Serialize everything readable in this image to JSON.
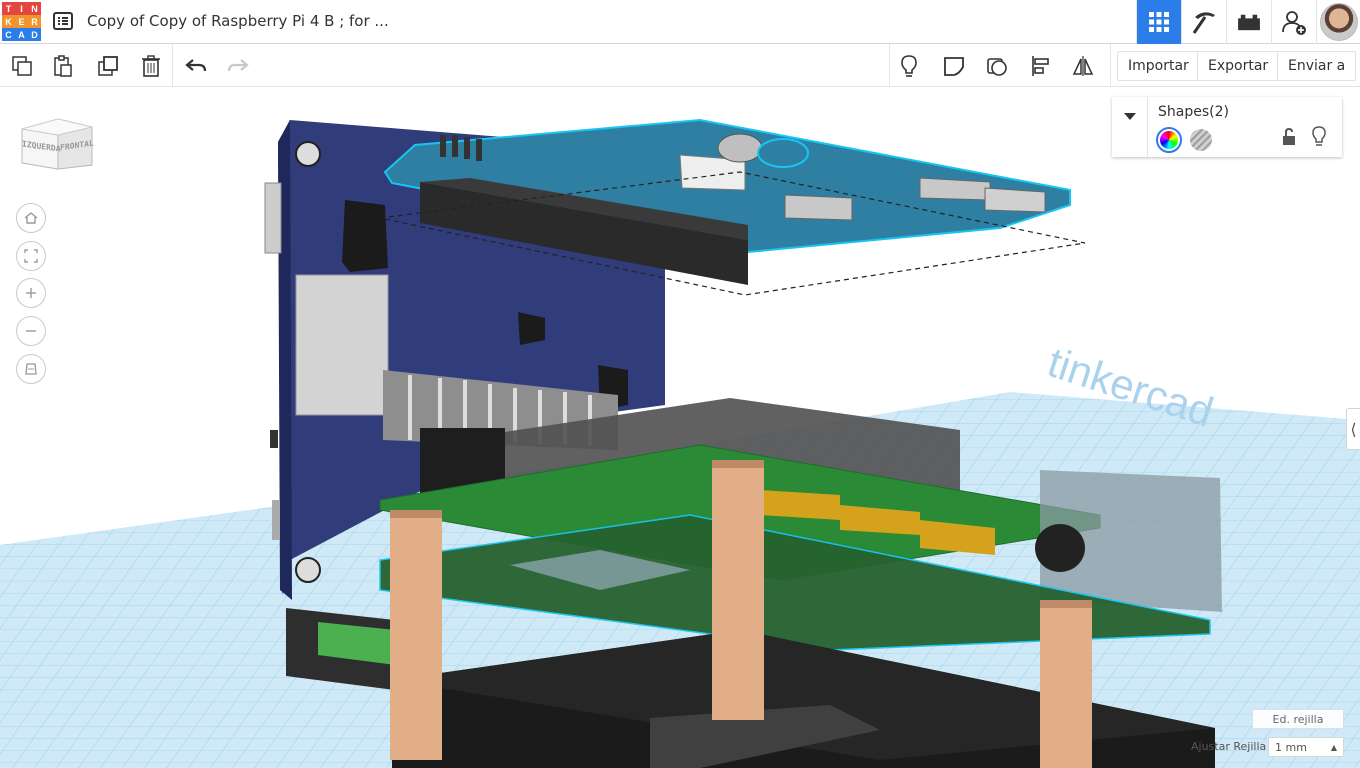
{
  "app": {
    "logo_letters": [
      "T",
      "I",
      "N",
      "K",
      "E",
      "R",
      "C",
      "A",
      "D"
    ],
    "logo_colors": [
      "#e2463f",
      "#e2463f",
      "#e2463f",
      "#f29330",
      "#f29330",
      "#f29330",
      "#2b7de9",
      "#2b7de9",
      "#2b7de9"
    ],
    "title": "Copy of Copy of Raspberry Pi 4 B ; for ...",
    "accent": "#2b7de9"
  },
  "topbar": {
    "icons": [
      "grid-view-icon",
      "pickaxe-icon",
      "bricks-icon",
      "add-user-icon",
      "avatar"
    ]
  },
  "toolbar": {
    "tools": [
      "copy-icon",
      "paste-icon",
      "duplicate-icon",
      "trash-icon",
      "undo-icon",
      "redo-icon"
    ],
    "view_tools": [
      "lightbulb-icon",
      "note-icon",
      "workplane-icon",
      "align-icon",
      "mirror-icon"
    ],
    "import_label": "Importar",
    "export_label": "Exportar",
    "send_label": "Enviar a"
  },
  "viewcube": {
    "left_face": "IZQUERDA",
    "front_face": "FRONTAL"
  },
  "nav_controls": [
    "home-icon",
    "fit-icon",
    "zoom-in-icon",
    "zoom-out-icon",
    "perspective-icon"
  ],
  "shapes_panel": {
    "title": "Shapes(2)"
  },
  "grid": {
    "edit_grid_label": "Ed. rejilla",
    "snap_label": "Ajustar Rejilla",
    "snap_value": "1 mm"
  }
}
